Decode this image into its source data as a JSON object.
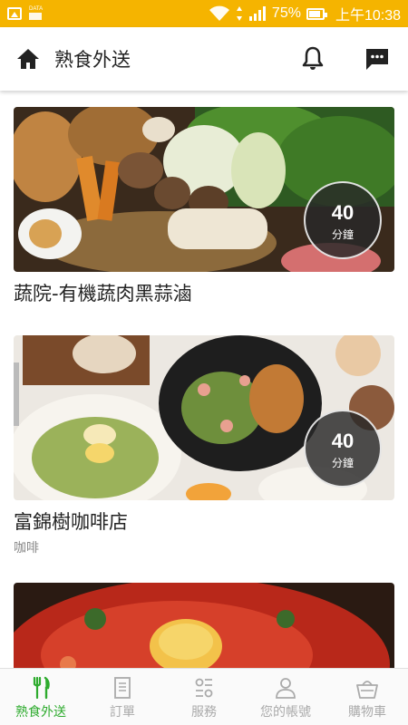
{
  "statusbar": {
    "data_label": "DATA",
    "battery": "75%",
    "time": "上午10:38"
  },
  "header": {
    "title": "熟食外送"
  },
  "restaurants": [
    {
      "name": "蔬院-有機蔬肉黑蒜滷",
      "category": "",
      "time_value": "40",
      "time_unit": "分鐘"
    },
    {
      "name": "富錦樹咖啡店",
      "category": "咖啡",
      "time_value": "40",
      "time_unit": "分鐘"
    },
    {
      "name": "",
      "category": "",
      "time_value": "",
      "time_unit": ""
    }
  ],
  "bottom_nav": [
    {
      "label": "熟食外送",
      "icon": "fork-knife-icon",
      "active": true
    },
    {
      "label": "訂單",
      "icon": "document-icon",
      "active": false
    },
    {
      "label": "服務",
      "icon": "service-icon",
      "active": false
    },
    {
      "label": "您的帳號",
      "icon": "person-icon",
      "active": false
    },
    {
      "label": "購物車",
      "icon": "basket-icon",
      "active": false
    }
  ],
  "colors": {
    "statusbar": "#f5b400",
    "active_nav": "#2eab2e",
    "inactive_nav": "#aaaaaa"
  }
}
